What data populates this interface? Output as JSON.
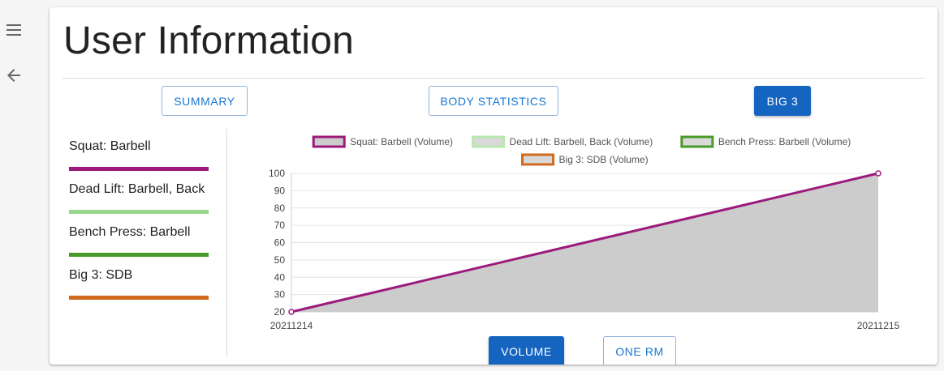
{
  "nav": {
    "menu_icon": "hamburger-menu-icon",
    "back_icon": "arrow-left-icon"
  },
  "page": {
    "title": "User Information"
  },
  "tabs": [
    {
      "label": "SUMMARY",
      "active": false
    },
    {
      "label": "BODY STATISTICS",
      "active": false
    },
    {
      "label": "BIG 3",
      "active": true
    }
  ],
  "exercises": [
    {
      "label": "Squat: Barbell",
      "color": "#9c1a7c"
    },
    {
      "label": "Dead Lift: Barbell, Back",
      "color": "#98d68e"
    },
    {
      "label": "Bench Press: Barbell",
      "color": "#4a9a2a"
    },
    {
      "label": "Big 3: SDB",
      "color": "#cf6a1e"
    }
  ],
  "metric_toggle": [
    {
      "label": "VOLUME",
      "active": true
    },
    {
      "label": "ONE RM",
      "active": false
    }
  ],
  "colors": {
    "primary": "#1565c0",
    "area_fill": "#cccccc",
    "grid": "#e5e5e5"
  },
  "chart_data": {
    "type": "area",
    "x": [
      "20211214",
      "20211215"
    ],
    "series": [
      {
        "name": "Squat: Barbell (Volume)",
        "values": [
          20,
          100
        ],
        "color": "#9c1a7c",
        "fill": "#cccccc"
      },
      {
        "name": "Dead Lift: Barbell, Back (Volume)",
        "values": [],
        "color": "#b7e8af",
        "fill": "#d9d9d9"
      },
      {
        "name": "Bench Press: Barbell (Volume)",
        "values": [],
        "color": "#4a9a2a",
        "fill": "#d9d9d9"
      },
      {
        "name": "Big 3: SDB (Volume)",
        "values": [],
        "color": "#cf6a1e",
        "fill": "#d9d9d9"
      }
    ],
    "yticks": [
      20,
      30,
      40,
      50,
      60,
      70,
      80,
      90,
      100
    ],
    "ylim": [
      20,
      100
    ],
    "grid": true,
    "legend": "top"
  }
}
